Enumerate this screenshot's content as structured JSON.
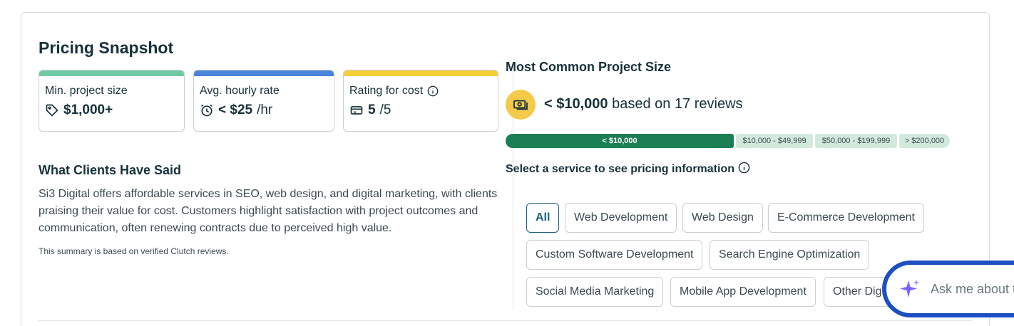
{
  "title": "Pricing Snapshot",
  "metrics": [
    {
      "label": "Min. project size",
      "value": "$1,000+",
      "unit": "",
      "icon": "tag-icon",
      "color": "#6fcaa3"
    },
    {
      "label": "Avg. hourly rate",
      "value": "< $25",
      "unit": "/hr",
      "icon": "alarm-clock-icon",
      "color": "#4a84dd"
    },
    {
      "label": "Rating for cost",
      "value": "5",
      "unit": "/5",
      "icon": "money-card-icon",
      "color": "#f5cf3a"
    }
  ],
  "clients": {
    "heading": "What Clients Have Said",
    "body": "Si3 Digital offers affordable services in SEO, web design, and digital marketing, with clients praising their value for cost. Customers highlight satisfaction with project outcomes and communication, often renewing contracts due to perceived high value.",
    "note": "This summary is based on verified Clutch reviews."
  },
  "common_project": {
    "heading": "Most Common Project Size",
    "value": "< $10,000",
    "suffix": "based on 17 reviews"
  },
  "distribution": [
    {
      "label": "< $10,000",
      "primary": true
    },
    {
      "label": "$10,000 - $49,999",
      "primary": false
    },
    {
      "label": "$50,000 - $199,999",
      "primary": false
    },
    {
      "label": "> $200,000",
      "primary": false
    }
  ],
  "services": {
    "heading": "Select a service to see pricing information",
    "chips": [
      "All",
      "Web Development",
      "Web Design",
      "E-Commerce Development",
      "Custom Software Development",
      "Search Engine Optimization",
      "Social Media Marketing",
      "Mobile App Development",
      "Other Digi"
    ],
    "selected": "All"
  },
  "ask": {
    "label": "Ask me about t"
  },
  "colors": {
    "primary_green": "#1a8053",
    "light_green": "#d2eadd",
    "accent_blue": "#1a5f82",
    "ask_border": "#1d4fc4",
    "coin": "#f5c94a"
  }
}
